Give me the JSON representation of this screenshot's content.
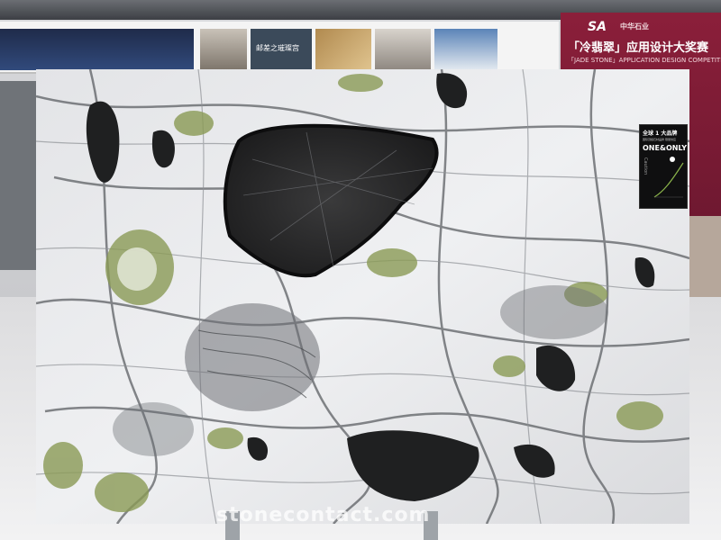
{
  "redboard": {
    "logo": "SA",
    "logo_sub": "中华石业",
    "title": "「冷翡翠」应用设计大奖赛",
    "subtitle": "「JADE STONE」APPLICATION DESIGN COMPETITION"
  },
  "banner": {
    "caption": "邮差之璀璨宫"
  },
  "slab_label": {
    "top": "全球 1 大品牌",
    "mid": "国际顶级石材品牌 限量供应",
    "big": "ONE&ONLY",
    "side": "Caution"
  },
  "watermark": "stonecontact.com",
  "colors": {
    "marble_base": "#e6e7ea",
    "marble_dark": "#2a2b2d",
    "marble_green": "#8a9a55",
    "board_red": "#8b1f3a"
  }
}
